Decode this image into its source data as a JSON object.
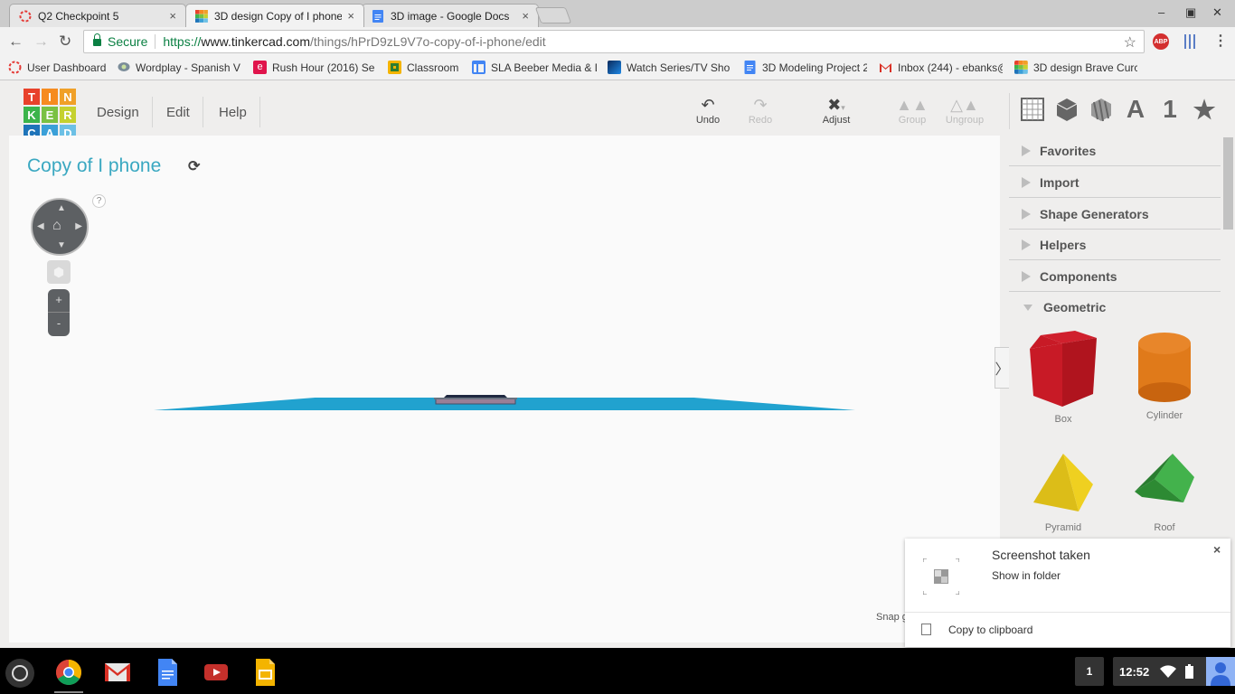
{
  "browser": {
    "tabs": [
      {
        "label": "Q2 Checkpoint 5",
        "icon": "checkpoint-icon",
        "active": false
      },
      {
        "label": "3D design Copy of I phone",
        "icon": "tinkercad-icon",
        "active": true
      },
      {
        "label": "3D image - Google Docs",
        "icon": "google-docs-icon",
        "active": false
      }
    ],
    "close_glyph": "×",
    "window": {
      "minimize": "–",
      "restore": "▣",
      "close": "✕"
    },
    "address": {
      "secure_label": "Secure",
      "scheme": "https://",
      "host": "www.tinkercad.com",
      "path": "/things/hPrD9zL9V7o-copy-of-i-phone/edit"
    },
    "extension_abp": "ABP",
    "bookmarks": [
      {
        "label": "User Dashboard",
        "icon": "checkpoint-icon",
        "color": "#e53935"
      },
      {
        "label": "Wordplay - Spanish V",
        "icon": "chat-bubble-icon",
        "color": "#7a8c99"
      },
      {
        "label": "Rush Hour (2016) Se",
        "icon": "e-icon",
        "color": "#e0144c"
      },
      {
        "label": "Classroom",
        "icon": "classroom-icon",
        "color": "#f4b400"
      },
      {
        "label": "SLA Beeber Media & D",
        "icon": "sites-icon",
        "color": "#4285f4"
      },
      {
        "label": "Watch Series/TV Sho",
        "icon": "watch-series-icon",
        "color": "#0a2a5c"
      },
      {
        "label": "3D Modeling Project 2",
        "icon": "google-docs-icon",
        "color": "#4285f4"
      },
      {
        "label": "Inbox (244) - ebanks@",
        "icon": "gmail-icon",
        "color": "#d93025"
      },
      {
        "label": "3D design Brave Curc",
        "icon": "tinkercad-icon",
        "color": "#f68b1f"
      }
    ]
  },
  "app": {
    "logo_letters": [
      "T",
      "I",
      "N",
      "K",
      "E",
      "R",
      "C",
      "A",
      "D"
    ],
    "logo_colors": [
      "#e8412b",
      "#f68b1f",
      "#f0a028",
      "#3cb44b",
      "#7ac142",
      "#c5d12f",
      "#1e74b9",
      "#3aa0d8",
      "#6cc0e5"
    ],
    "menu": [
      "Design",
      "Edit",
      "Help"
    ],
    "toolbar": {
      "undo": "Undo",
      "redo": "Redo",
      "adjust": "Adjust",
      "group": "Group",
      "ungroup": "Ungroup"
    },
    "view_icons": [
      "workplane-icon",
      "solid-box-icon",
      "hole-box-icon",
      "text-icon",
      "number-icon",
      "star-icon"
    ],
    "view_glyphs": {
      "text": "A",
      "number": "1",
      "star": "★"
    },
    "design_title": "Copy of I phone",
    "help_glyph": "?",
    "zoom_in": "+",
    "zoom_out": "-",
    "snap_label": "Snap g",
    "plane_color": "#21a2cf",
    "categories": [
      {
        "label": "Favorites",
        "open": false
      },
      {
        "label": "Import",
        "open": false
      },
      {
        "label": "Shape Generators",
        "open": false
      },
      {
        "label": "Helpers",
        "open": false
      },
      {
        "label": "Components",
        "open": false
      },
      {
        "label": "Geometric",
        "open": true
      }
    ],
    "shapes": [
      {
        "label": "Box",
        "color": "#c81a26"
      },
      {
        "label": "Cylinder",
        "color": "#e07a1a"
      },
      {
        "label": "Pyramid",
        "color": "#e8c51c"
      },
      {
        "label": "Roof",
        "color": "#3aa843"
      }
    ]
  },
  "notification": {
    "title": "Screenshot taken",
    "action": "Show in folder",
    "copy": "Copy to clipboard",
    "close": "×"
  },
  "shelf": {
    "apps": [
      "chrome-icon",
      "gmail-icon",
      "google-docs-icon",
      "youtube-icon",
      "google-slides-icon"
    ],
    "tray_count": "1",
    "time": "12:52"
  }
}
